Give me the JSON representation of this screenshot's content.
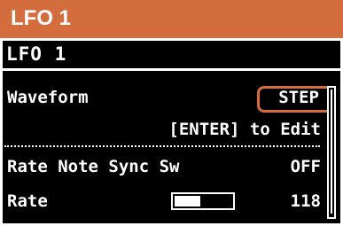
{
  "header": {
    "title": "LFO 1"
  },
  "screen": {
    "title": "LFO 1",
    "rows": [
      {
        "label": "Waveform",
        "value": "STEP"
      },
      {
        "label": "Rate Note Sync Sw",
        "value": "OFF"
      },
      {
        "label": "Rate",
        "value": "118",
        "slider_fraction": 0.45
      }
    ],
    "hint": "[ENTER] to Edit"
  },
  "colors": {
    "accent": "#d36d3e",
    "lcd_background": "#000000",
    "lcd_text": "#ffffff"
  }
}
